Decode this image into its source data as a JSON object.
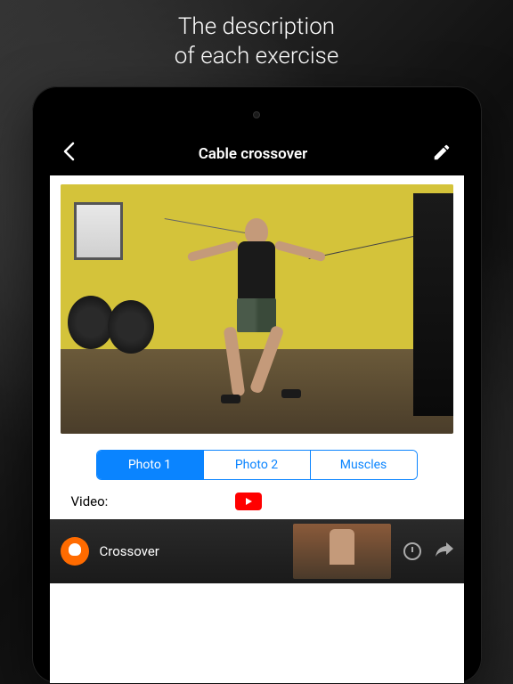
{
  "marketing": {
    "line1": "The description",
    "line2": "of each exercise"
  },
  "navbar": {
    "title": "Cable crossover"
  },
  "segments": {
    "photo1": "Photo 1",
    "photo2": "Photo 2",
    "muscles": "Muscles"
  },
  "video": {
    "label": "Video:",
    "title": "Crossover"
  },
  "colors": {
    "accent": "#0a84ff",
    "youtube": "#ff0000"
  }
}
